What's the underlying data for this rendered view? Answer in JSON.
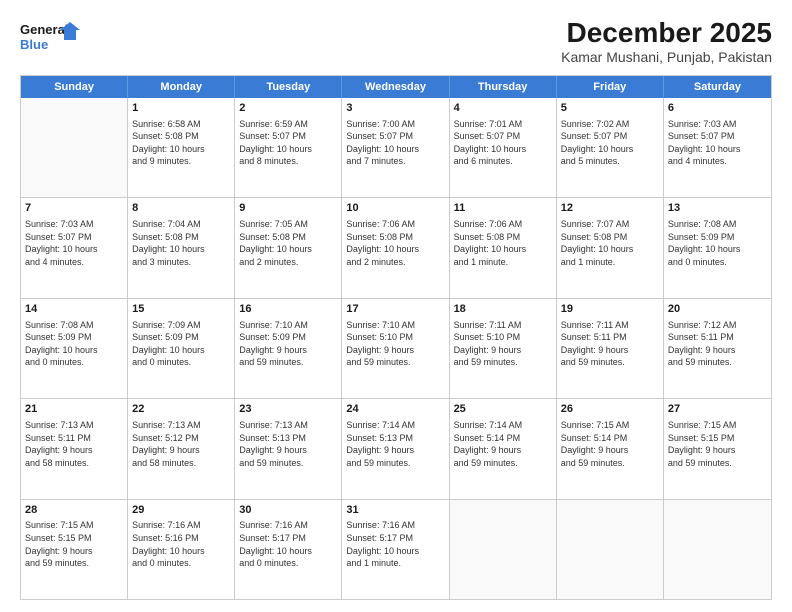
{
  "header": {
    "logo_line1": "General",
    "logo_line2": "Blue",
    "title": "December 2025",
    "subtitle": "Kamar Mushani, Punjab, Pakistan"
  },
  "days_of_week": [
    "Sunday",
    "Monday",
    "Tuesday",
    "Wednesday",
    "Thursday",
    "Friday",
    "Saturday"
  ],
  "weeks": [
    [
      {
        "day": "",
        "info": ""
      },
      {
        "day": "1",
        "info": "Sunrise: 6:58 AM\nSunset: 5:08 PM\nDaylight: 10 hours\nand 9 minutes."
      },
      {
        "day": "2",
        "info": "Sunrise: 6:59 AM\nSunset: 5:07 PM\nDaylight: 10 hours\nand 8 minutes."
      },
      {
        "day": "3",
        "info": "Sunrise: 7:00 AM\nSunset: 5:07 PM\nDaylight: 10 hours\nand 7 minutes."
      },
      {
        "day": "4",
        "info": "Sunrise: 7:01 AM\nSunset: 5:07 PM\nDaylight: 10 hours\nand 6 minutes."
      },
      {
        "day": "5",
        "info": "Sunrise: 7:02 AM\nSunset: 5:07 PM\nDaylight: 10 hours\nand 5 minutes."
      },
      {
        "day": "6",
        "info": "Sunrise: 7:03 AM\nSunset: 5:07 PM\nDaylight: 10 hours\nand 4 minutes."
      }
    ],
    [
      {
        "day": "7",
        "info": "Sunrise: 7:03 AM\nSunset: 5:07 PM\nDaylight: 10 hours\nand 4 minutes."
      },
      {
        "day": "8",
        "info": "Sunrise: 7:04 AM\nSunset: 5:08 PM\nDaylight: 10 hours\nand 3 minutes."
      },
      {
        "day": "9",
        "info": "Sunrise: 7:05 AM\nSunset: 5:08 PM\nDaylight: 10 hours\nand 2 minutes."
      },
      {
        "day": "10",
        "info": "Sunrise: 7:06 AM\nSunset: 5:08 PM\nDaylight: 10 hours\nand 2 minutes."
      },
      {
        "day": "11",
        "info": "Sunrise: 7:06 AM\nSunset: 5:08 PM\nDaylight: 10 hours\nand 1 minute."
      },
      {
        "day": "12",
        "info": "Sunrise: 7:07 AM\nSunset: 5:08 PM\nDaylight: 10 hours\nand 1 minute."
      },
      {
        "day": "13",
        "info": "Sunrise: 7:08 AM\nSunset: 5:09 PM\nDaylight: 10 hours\nand 0 minutes."
      }
    ],
    [
      {
        "day": "14",
        "info": "Sunrise: 7:08 AM\nSunset: 5:09 PM\nDaylight: 10 hours\nand 0 minutes."
      },
      {
        "day": "15",
        "info": "Sunrise: 7:09 AM\nSunset: 5:09 PM\nDaylight: 10 hours\nand 0 minutes."
      },
      {
        "day": "16",
        "info": "Sunrise: 7:10 AM\nSunset: 5:09 PM\nDaylight: 9 hours\nand 59 minutes."
      },
      {
        "day": "17",
        "info": "Sunrise: 7:10 AM\nSunset: 5:10 PM\nDaylight: 9 hours\nand 59 minutes."
      },
      {
        "day": "18",
        "info": "Sunrise: 7:11 AM\nSunset: 5:10 PM\nDaylight: 9 hours\nand 59 minutes."
      },
      {
        "day": "19",
        "info": "Sunrise: 7:11 AM\nSunset: 5:11 PM\nDaylight: 9 hours\nand 59 minutes."
      },
      {
        "day": "20",
        "info": "Sunrise: 7:12 AM\nSunset: 5:11 PM\nDaylight: 9 hours\nand 59 minutes."
      }
    ],
    [
      {
        "day": "21",
        "info": "Sunrise: 7:13 AM\nSunset: 5:11 PM\nDaylight: 9 hours\nand 58 minutes."
      },
      {
        "day": "22",
        "info": "Sunrise: 7:13 AM\nSunset: 5:12 PM\nDaylight: 9 hours\nand 58 minutes."
      },
      {
        "day": "23",
        "info": "Sunrise: 7:13 AM\nSunset: 5:13 PM\nDaylight: 9 hours\nand 59 minutes."
      },
      {
        "day": "24",
        "info": "Sunrise: 7:14 AM\nSunset: 5:13 PM\nDaylight: 9 hours\nand 59 minutes."
      },
      {
        "day": "25",
        "info": "Sunrise: 7:14 AM\nSunset: 5:14 PM\nDaylight: 9 hours\nand 59 minutes."
      },
      {
        "day": "26",
        "info": "Sunrise: 7:15 AM\nSunset: 5:14 PM\nDaylight: 9 hours\nand 59 minutes."
      },
      {
        "day": "27",
        "info": "Sunrise: 7:15 AM\nSunset: 5:15 PM\nDaylight: 9 hours\nand 59 minutes."
      }
    ],
    [
      {
        "day": "28",
        "info": "Sunrise: 7:15 AM\nSunset: 5:15 PM\nDaylight: 9 hours\nand 59 minutes."
      },
      {
        "day": "29",
        "info": "Sunrise: 7:16 AM\nSunset: 5:16 PM\nDaylight: 10 hours\nand 0 minutes."
      },
      {
        "day": "30",
        "info": "Sunrise: 7:16 AM\nSunset: 5:17 PM\nDaylight: 10 hours\nand 0 minutes."
      },
      {
        "day": "31",
        "info": "Sunrise: 7:16 AM\nSunset: 5:17 PM\nDaylight: 10 hours\nand 1 minute."
      },
      {
        "day": "",
        "info": ""
      },
      {
        "day": "",
        "info": ""
      },
      {
        "day": "",
        "info": ""
      }
    ]
  ]
}
